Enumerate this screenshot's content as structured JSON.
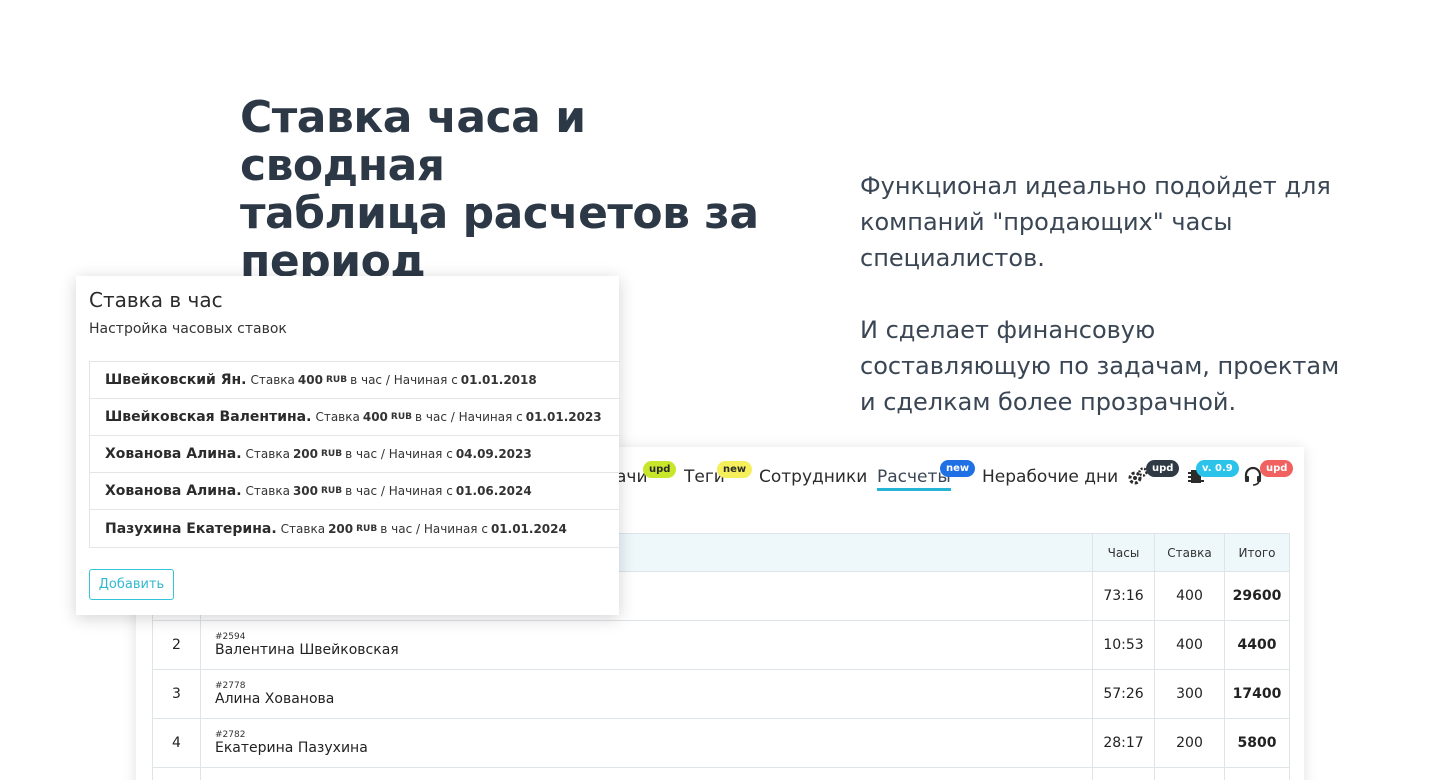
{
  "headline": [
    "Ставка часа и сводная",
    "таблица расчетов за",
    "период"
  ],
  "description": [
    [
      "Функционал идеально подойдет для",
      "компаний \"продающих\" часы",
      "специалистов."
    ],
    [
      "И сделает финансовую",
      "составляющую по задачам, проектам",
      "и сделкам более прозрачной."
    ]
  ],
  "nav": {
    "items": [
      {
        "label": "ачи",
        "badge": "upd"
      },
      {
        "label": "Теги",
        "badge": "new"
      },
      {
        "label": "Сотрудники",
        "badge": ""
      },
      {
        "label": "Расчеты",
        "badge": "new",
        "active": true
      },
      {
        "label": "Нерабочие дни",
        "badge": ""
      }
    ],
    "icons": [
      {
        "icon": "gears-icon",
        "badge": "upd"
      },
      {
        "icon": "chip-icon",
        "badge": "v. 0.9"
      },
      {
        "icon": "headset-icon",
        "badge": "upd"
      }
    ],
    "colors": {
      "accent": "#27b3d6",
      "lime": "#c8e62a",
      "yellow": "#f4ef5a",
      "blue": "#1f6fe5",
      "dark": "#2f3a45",
      "cyan": "#2cc3ea",
      "red": "#f0615f"
    }
  },
  "table": {
    "headers": {
      "hours": "Часы",
      "rate": "Ставка",
      "total": "Итого"
    },
    "rows": [
      {
        "num": "",
        "ticket": "",
        "name": "",
        "hours": "73:16",
        "rate": "400",
        "total": "29600"
      },
      {
        "num": "2",
        "ticket": "#2594",
        "name": "Валентина Швейковская",
        "hours": "10:53",
        "rate": "400",
        "total": "4400"
      },
      {
        "num": "3",
        "ticket": "#2778",
        "name": "Алина Хованова",
        "hours": "57:26",
        "rate": "300",
        "total": "17400"
      },
      {
        "num": "4",
        "ticket": "#2782",
        "name": "Екатерина Пазухина",
        "hours": "28:17",
        "rate": "200",
        "total": "5800"
      }
    ]
  },
  "rate_card": {
    "title": "Ставка в час",
    "subtitle": "Настройка часовых ставок",
    "rate_word": "Ставка",
    "currency": "RUB",
    "per_hour": "в час / Начиная с",
    "items": [
      {
        "name": "Швейковский Ян.",
        "rate": "400",
        "date": "01.01.2018"
      },
      {
        "name": "Швейковская Валентина.",
        "rate": "400",
        "date": "01.01.2023"
      },
      {
        "name": "Хованова Алина.",
        "rate": "200",
        "date": "04.09.2023"
      },
      {
        "name": "Хованова Алина.",
        "rate": "300",
        "date": "01.06.2024"
      },
      {
        "name": "Пазухина Екатерина.",
        "rate": "200",
        "date": "01.01.2024"
      }
    ],
    "add_button": "Добавить"
  }
}
